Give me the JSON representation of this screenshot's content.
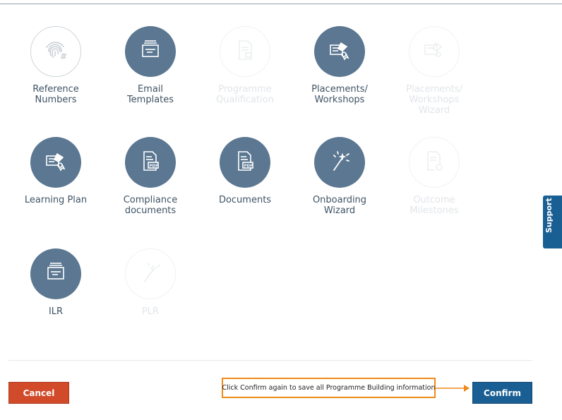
{
  "tiles": [
    {
      "label_lines": [
        "Reference",
        "Numbers"
      ],
      "icon": "fingerprint-icon",
      "state": "outline"
    },
    {
      "label_lines": [
        "Email",
        "Templates"
      ],
      "icon": "email-template-icon",
      "state": "enabled"
    },
    {
      "label_lines": [
        "Programme",
        "Qualification"
      ],
      "icon": "qualification-doc-icon",
      "state": "disabled"
    },
    {
      "label_lines": [
        "Placements/",
        "Workshops"
      ],
      "icon": "certificate-icon",
      "state": "enabled"
    },
    {
      "label_lines": [
        "Placements/",
        "Workshops",
        "Wizard"
      ],
      "icon": "certificate-icon",
      "state": "disabled"
    },
    {
      "label_lines": [
        "Learning Plan"
      ],
      "icon": "certificate-icon",
      "state": "enabled"
    },
    {
      "label_lines": [
        "Compliance",
        "documents"
      ],
      "icon": "pdf-document-icon",
      "state": "enabled"
    },
    {
      "label_lines": [
        "Documents"
      ],
      "icon": "pdf-document-icon",
      "state": "enabled"
    },
    {
      "label_lines": [
        "Onboarding",
        "Wizard"
      ],
      "icon": "magic-wand-icon",
      "state": "enabled"
    },
    {
      "label_lines": [
        "Outcome",
        "Milestones"
      ],
      "icon": "doc-gear-icon",
      "state": "disabled"
    },
    {
      "label_lines": [
        "ILR"
      ],
      "icon": "form-icon",
      "state": "enabled"
    },
    {
      "label_lines": [
        "PLR"
      ],
      "icon": "magic-wand-icon",
      "state": "disabled"
    }
  ],
  "footer": {
    "cancel_label": "Cancel",
    "confirm_label": "Confirm",
    "callout_text": "Click Confirm again to save all Programme Building information"
  },
  "support_tab": {
    "label": "Support"
  },
  "colors": {
    "accent": "#5b7791",
    "confirm": "#1a5f93",
    "cancel": "#d14a2a",
    "callout_border": "#f08a1a",
    "disabled_text": "#e1e5e9"
  }
}
